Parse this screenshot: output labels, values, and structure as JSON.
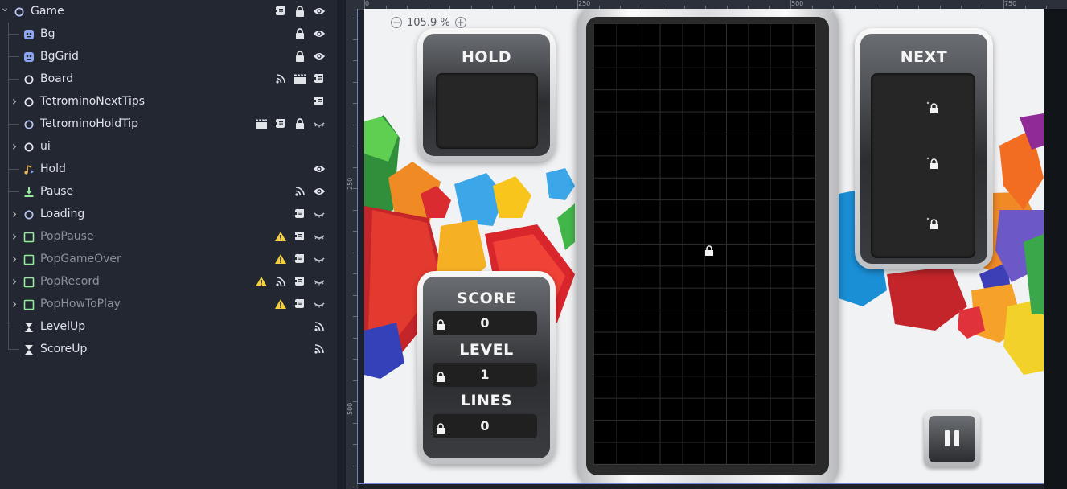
{
  "scene_tree": {
    "nodes": [
      {
        "name": "Game",
        "icon": "node-circle-icon",
        "depth": 0,
        "expand": "expanded",
        "tools": [
          "script-icon",
          "lock-icon",
          "visibility-icon"
        ],
        "dim": false
      },
      {
        "name": "Bg",
        "icon": "sprite-icon",
        "depth": 1,
        "expand": "none",
        "tools": [
          "lock-icon",
          "visibility-icon"
        ],
        "dim": false
      },
      {
        "name": "BgGrid",
        "icon": "sprite-icon",
        "depth": 1,
        "expand": "none",
        "tools": [
          "lock-icon",
          "visibility-icon"
        ],
        "dim": false
      },
      {
        "name": "Board",
        "icon": "node2d-circle-icon",
        "depth": 1,
        "expand": "none",
        "tools": [
          "signal-icon",
          "scene-clapper-icon",
          "script-icon"
        ],
        "dim": false
      },
      {
        "name": "TetrominoNextTips",
        "icon": "node2d-circle-icon",
        "depth": 1,
        "expand": "collapsed",
        "tools": [
          "script-icon"
        ],
        "dim": false
      },
      {
        "name": "TetrominoHoldTip",
        "icon": "node-circle-icon",
        "depth": 1,
        "expand": "none",
        "tools": [
          "scene-clapper-icon",
          "script-icon",
          "lock-icon",
          "visibility-hidden-icon"
        ],
        "dim": false
      },
      {
        "name": "ui",
        "icon": "node2d-circle-icon",
        "depth": 1,
        "expand": "collapsed",
        "tools": [],
        "dim": false
      },
      {
        "name": "Hold",
        "icon": "audio-player-icon",
        "depth": 1,
        "expand": "none",
        "tools": [
          "visibility-icon"
        ],
        "dim": false
      },
      {
        "name": "Pause",
        "icon": "input-download-icon",
        "depth": 1,
        "expand": "none",
        "tools": [
          "signal-icon",
          "visibility-icon"
        ],
        "dim": false
      },
      {
        "name": "Loading",
        "icon": "node-circle-icon",
        "depth": 1,
        "expand": "collapsed",
        "tools": [
          "script-icon",
          "visibility-hidden-icon"
        ],
        "dim": false
      },
      {
        "name": "PopPause",
        "icon": "control-box-icon",
        "depth": 1,
        "expand": "collapsed",
        "tools": [
          "warning-icon",
          "script-icon",
          "visibility-hidden-icon"
        ],
        "dim": true
      },
      {
        "name": "PopGameOver",
        "icon": "control-box-icon",
        "depth": 1,
        "expand": "collapsed",
        "tools": [
          "warning-icon",
          "script-icon",
          "visibility-hidden-icon"
        ],
        "dim": true
      },
      {
        "name": "PopRecord",
        "icon": "control-box-icon",
        "depth": 1,
        "expand": "collapsed",
        "tools": [
          "warning-icon",
          "signal-icon",
          "script-icon",
          "visibility-hidden-icon"
        ],
        "dim": true
      },
      {
        "name": "PopHowToPlay",
        "icon": "control-box-icon",
        "depth": 1,
        "expand": "collapsed",
        "tools": [
          "warning-icon",
          "script-icon",
          "visibility-hidden-icon"
        ],
        "dim": true
      },
      {
        "name": "LevelUp",
        "icon": "timer-icon",
        "depth": 1,
        "expand": "none",
        "tools": [
          "signal-icon"
        ],
        "dim": false
      },
      {
        "name": "ScoreUp",
        "icon": "timer-icon",
        "depth": 1,
        "expand": "none",
        "tools": [
          "signal-icon"
        ],
        "dim": false
      }
    ]
  },
  "viewport": {
    "zoom_label": "105.9 %",
    "ruler_top_labels": [
      "0",
      "250",
      "500",
      "750"
    ],
    "ruler_left_labels": [
      "250",
      "500"
    ]
  },
  "game": {
    "hold_title": "HOLD",
    "next_title": "NEXT",
    "score_title": "SCORE",
    "score_value": "0",
    "level_title": "LEVEL",
    "level_value": "1",
    "lines_title": "LINES",
    "lines_value": "0"
  },
  "colors": {
    "editor_bg": "#222732",
    "selection_blue": "#6a87c8",
    "warning_yellow": "#f5d142",
    "sprite_blue": "#8da5f3",
    "control_green": "#8eef97"
  }
}
